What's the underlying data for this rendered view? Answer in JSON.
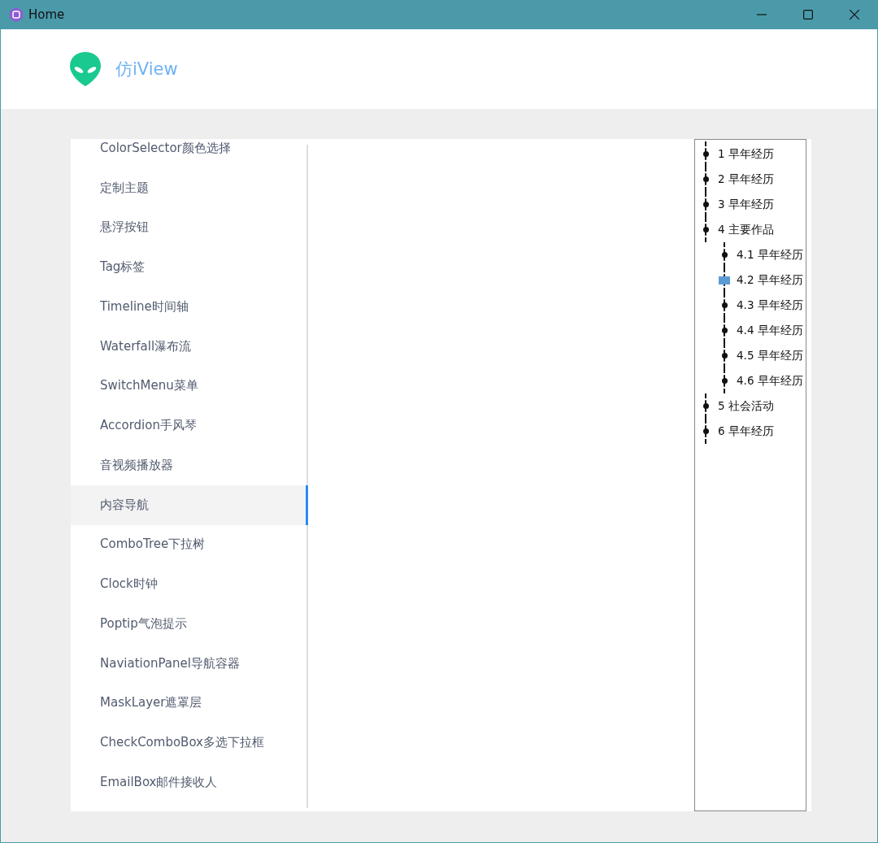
{
  "window": {
    "title": "Home"
  },
  "header": {
    "title": "仿iView"
  },
  "menu": {
    "items": [
      {
        "label": "ColorSelector颜色选择",
        "selected": false
      },
      {
        "label": "定制主题",
        "selected": false
      },
      {
        "label": "悬浮按钮",
        "selected": false
      },
      {
        "label": "Tag标签",
        "selected": false
      },
      {
        "label": "Timeline时间轴",
        "selected": false
      },
      {
        "label": "Waterfall瀑布流",
        "selected": false
      },
      {
        "label": "SwitchMenu菜单",
        "selected": false
      },
      {
        "label": "Accordion手风琴",
        "selected": false
      },
      {
        "label": "音视频播放器",
        "selected": false
      },
      {
        "label": "内容导航",
        "selected": true
      },
      {
        "label": "ComboTree下拉树",
        "selected": false
      },
      {
        "label": "Clock时钟",
        "selected": false
      },
      {
        "label": "Poptip气泡提示",
        "selected": false
      },
      {
        "label": "NaviationPanel导航容器",
        "selected": false
      },
      {
        "label": "MaskLayer遮罩层",
        "selected": false
      },
      {
        "label": "CheckComboBox多选下拉框",
        "selected": false
      },
      {
        "label": "EmailBox邮件接收人",
        "selected": false
      }
    ]
  },
  "content_nav": {
    "items": [
      {
        "label": "1 早年经历",
        "selected": false
      },
      {
        "label": "2 早年经历",
        "selected": false
      },
      {
        "label": "3 早年经历",
        "selected": false
      },
      {
        "label": "4 主要作品",
        "selected": false,
        "children": [
          {
            "label": "4.1 早年经历",
            "selected": false
          },
          {
            "label": "4.2 早年经历",
            "selected": true
          },
          {
            "label": "4.3 早年经历",
            "selected": false
          },
          {
            "label": "4.4 早年经历",
            "selected": false
          },
          {
            "label": "4.5 早年经历",
            "selected": false
          },
          {
            "label": "4.6 早年经历",
            "selected": false
          }
        ]
      },
      {
        "label": "5 社会活动",
        "selected": false
      },
      {
        "label": "6 早年经历",
        "selected": false
      }
    ]
  }
}
